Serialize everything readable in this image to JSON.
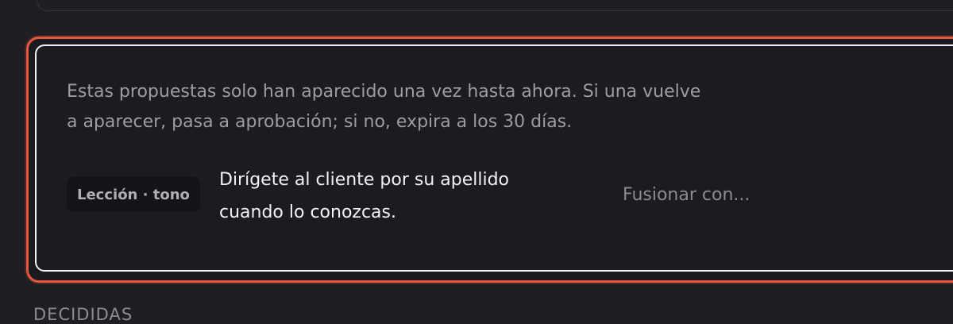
{
  "pending_card": {
    "notice": "Estas propuestas solo han aparecido una vez hasta ahora. Si una vuelve a aparecer, pasa a aprobación; si no, expira a los 30 días.",
    "item": {
      "badge": "Lección · tono",
      "text": "Dirígete al cliente por su apellido cuando lo conozcas.",
      "merge_label": "Fusionar con..."
    }
  },
  "decided_section": {
    "heading": "DECIDIDAS"
  },
  "colors": {
    "background": "#1f1e23",
    "card_highlight_border": "#e4573e",
    "card_inner_border": "#f6f2f2",
    "badge_background": "#141318",
    "muted_text": "#9e9ca3",
    "primary_text": "#f2f2f4"
  }
}
